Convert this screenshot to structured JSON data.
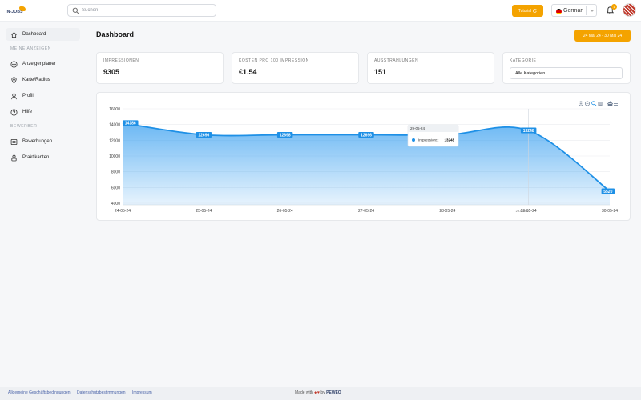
{
  "header": {
    "logo_text": "IN-JOBS",
    "search_placeholder": "Suchen",
    "tutorial_label": "Tutorial",
    "language_label": "German",
    "notification_count": "1"
  },
  "sidebar": {
    "items": [
      {
        "label": "Dashboard",
        "icon": "home-icon",
        "active": true
      },
      {
        "label": "Anzeigenplaner",
        "icon": "planner-icon"
      },
      {
        "label": "Karte/Radius",
        "icon": "map-pin-icon"
      },
      {
        "label": "Profil",
        "icon": "user-icon"
      },
      {
        "label": "Hilfe",
        "icon": "help-icon"
      },
      {
        "label": "Bewerbungen",
        "icon": "applications-icon"
      },
      {
        "label": "Praktikanten",
        "icon": "interns-icon"
      }
    ],
    "sections": [
      "MEINE ANZEIGEN",
      "BEWERBER"
    ]
  },
  "main": {
    "title": "Dashboard",
    "date_range": "24 Mai 24 - 30 Mai 24",
    "cards": [
      {
        "label": "IMPRESSIONEN",
        "value": "9305"
      },
      {
        "label": "KOSTEN PRO 100 IMPRESSION",
        "value": "€1.54"
      },
      {
        "label": "AUSSTRAHLUNGEN",
        "value": "151"
      }
    ],
    "category": {
      "label": "KATEGORIE",
      "value": "Alle Kategorien"
    }
  },
  "chart_data": {
    "type": "area",
    "x": [
      "24-05-24",
      "25-05-24",
      "26-05-24",
      "27-05-24",
      "28-05-24",
      "29-05-24",
      "30-05-24"
    ],
    "series": [
      {
        "name": "Impressions",
        "values": [
          14186,
          12696,
          12698,
          12696,
          12698,
          13248,
          5520
        ]
      }
    ],
    "data_labels": [
      "14186",
      "12696",
      "12698",
      "12696",
      "",
      "13248",
      "5520"
    ],
    "ylim": [
      4000,
      16000
    ],
    "yticks": [
      4000,
      6000,
      8000,
      10000,
      12000,
      14000,
      16000
    ],
    "grid": true,
    "tooltip": {
      "date": "29-05-24",
      "series": "Impressions:",
      "value": "13248"
    },
    "colors": {
      "line": "#1e90e6",
      "fill": "#3aa0f0"
    }
  },
  "footer": {
    "links": [
      "Allgemeine Geschäftsbedingungen",
      "Datenschutzbestimmungen",
      "Impressum"
    ],
    "made_with": "Made with",
    "by": "by",
    "brand": "PEWEO"
  },
  "colors": {
    "accent": "#f4a300",
    "primary": "#1e90e6"
  }
}
